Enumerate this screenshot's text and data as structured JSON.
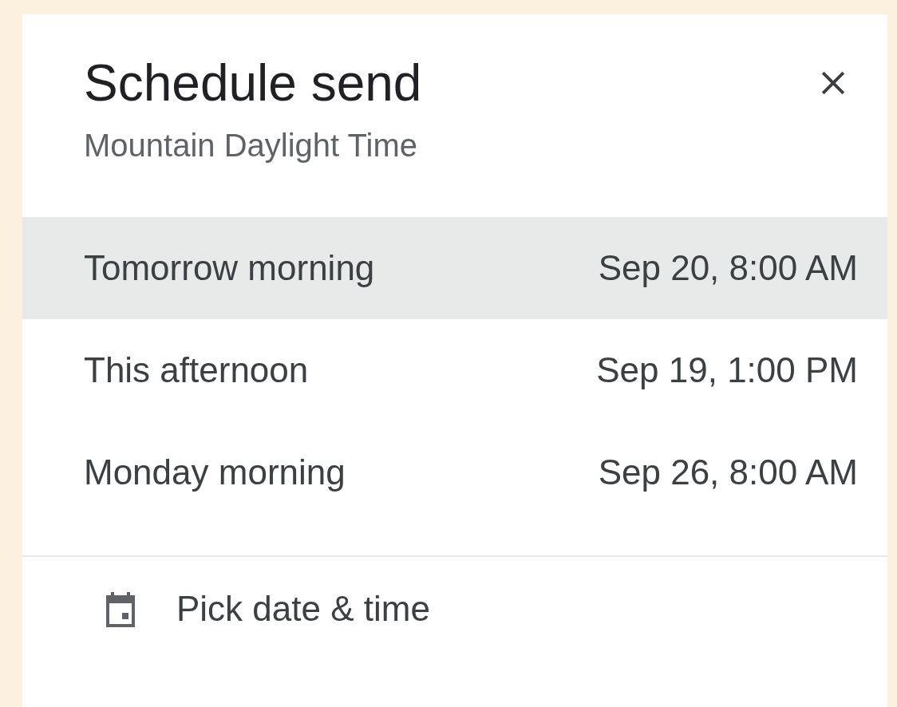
{
  "dialog": {
    "title": "Schedule send",
    "subtitle": "Mountain Daylight Time"
  },
  "options": [
    {
      "label": "Tomorrow morning",
      "time": "Sep 20, 8:00 AM",
      "selected": true
    },
    {
      "label": "This afternoon",
      "time": "Sep 19, 1:00 PM",
      "selected": false
    },
    {
      "label": "Monday morning",
      "time": "Sep 26, 8:00 AM",
      "selected": false
    }
  ],
  "custom": {
    "label": "Pick date & time"
  }
}
